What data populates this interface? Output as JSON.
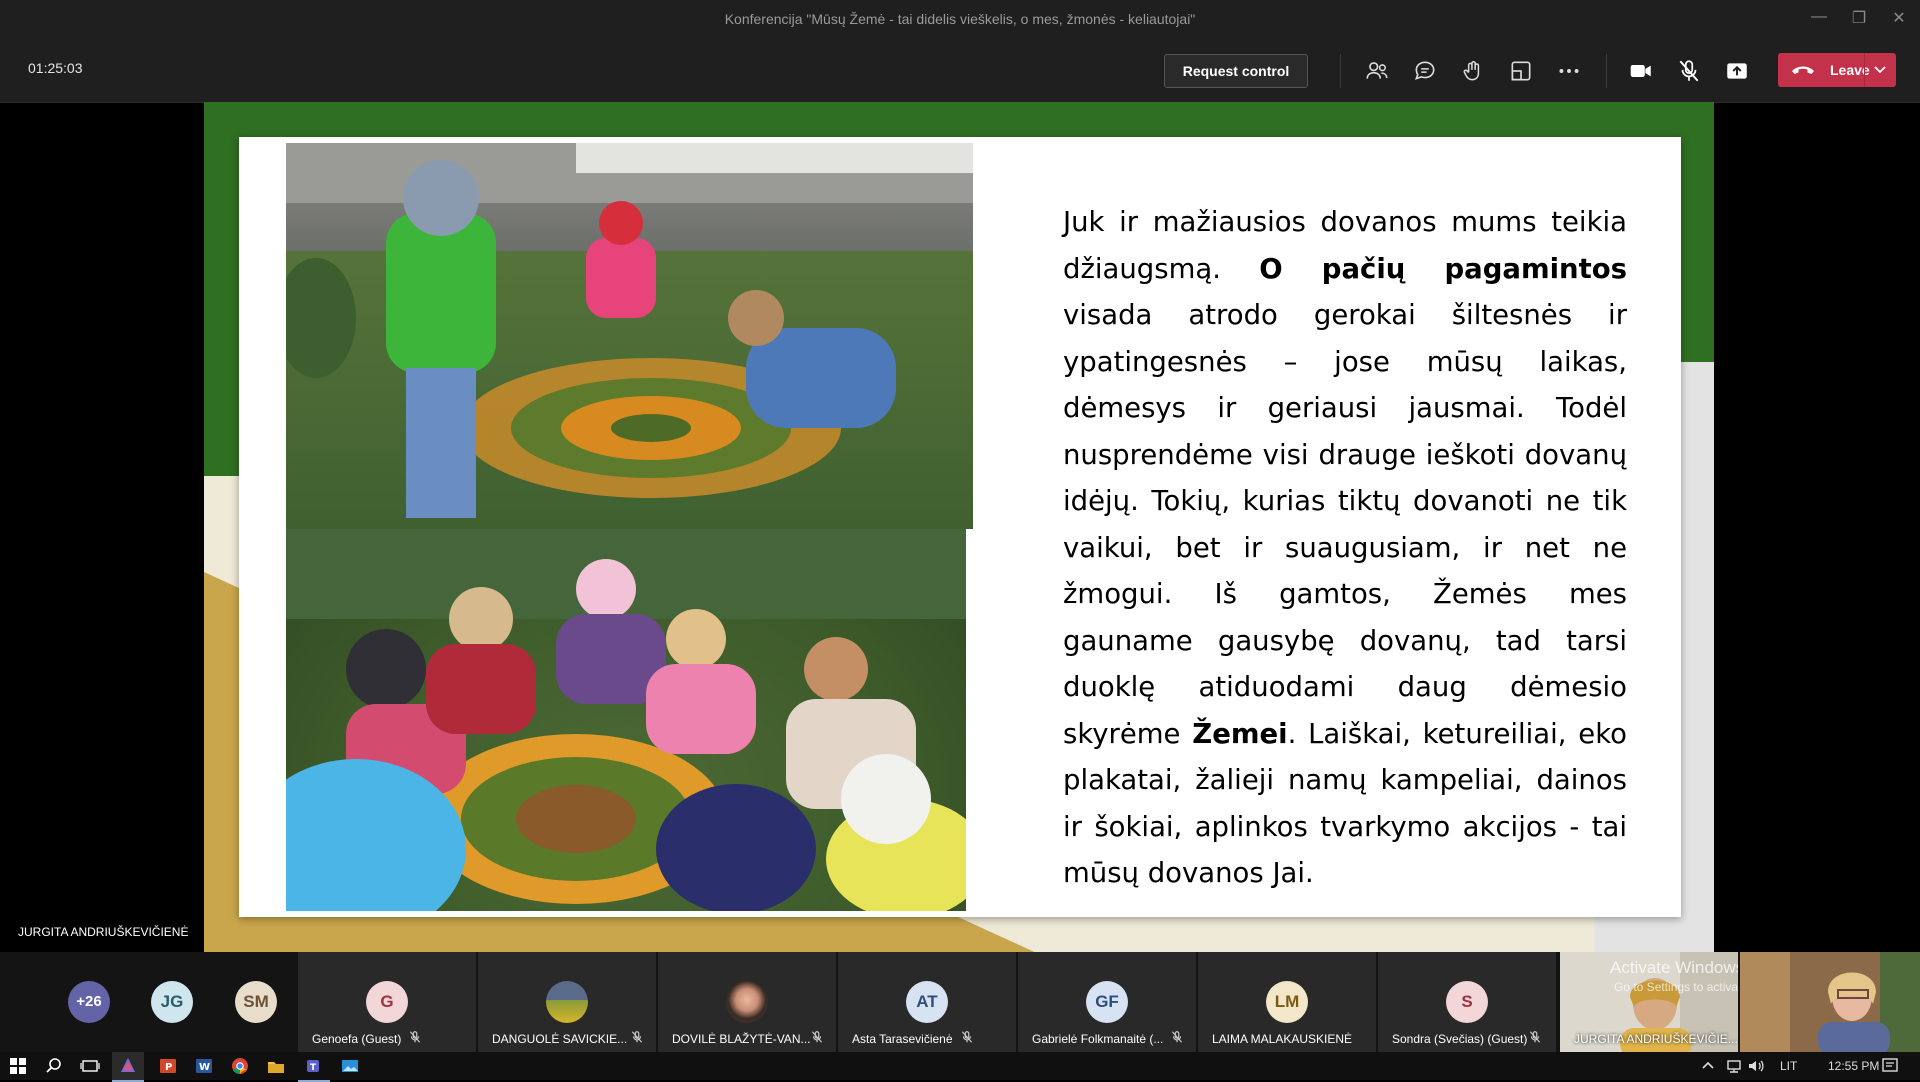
{
  "window": {
    "title": "Konferencija \"Mūsų Žemė - tai didelis vieškelis, o mes, žmonės - keliautojai\""
  },
  "toolbar": {
    "timer": "01:25:03",
    "request_control_label": "Request control",
    "leave_label": "Leave"
  },
  "slide": {
    "paragraph": [
      {
        "t": "Juk ir mažiausios dovanos mums teikia džiaugsmą. ",
        "b": false
      },
      {
        "t": "O pačių pagamintos",
        "b": true
      },
      {
        "t": " visada atrodo gerokai šiltesnės ir ypatingesnės – jose mūsų laikas, dėmesys ir geriausi jausmai. Todėl nusprendėme visi drauge ieškoti dovanų idėjų. Tokių, kurias tiktų dovanoti  ne tik vaikui, bet ir suaugusiam, ir net ne žmogui. Iš gamtos, Žemės mes gauname gausybę dovanų, tad tarsi duoklę atiduodami daug dėmesio skyrėme ",
        "b": false
      },
      {
        "t": "Žemei",
        "b": true
      },
      {
        "t": ". Laiškai, ketureiliai, eko plakatai, žalieji namų kampeliai, dainos ir šokiai, aplinkos tvarkymo akcijos  - tai mūsų dovanos Jai.",
        "b": false
      }
    ]
  },
  "presenter": {
    "name": "JURGITA ANDRIUŠKEVIČIENĖ"
  },
  "participants": {
    "overflow": "+26",
    "small_avatars": [
      {
        "initials": "JG",
        "color": "#cfe6ee"
      },
      {
        "initials": "SM",
        "color": "#e8dccb"
      }
    ],
    "tiles": [
      {
        "name": "Genoefa (Guest)",
        "initials": "G",
        "color": "#f3d6d8",
        "fg": "#a0323f"
      },
      {
        "name": "DANGUOLĖ SAVICKIE...",
        "initials": "",
        "color": "#6f7f46",
        "fg": "#fff"
      },
      {
        "name": "DOVILĖ BLAŽYTĖ-VAN...",
        "initials": "",
        "color": "#4a3a34",
        "fg": "#fff"
      },
      {
        "name": "Asta Tarasevičienė",
        "initials": "AT",
        "color": "#d7e3f3",
        "fg": "#2d4f7c"
      },
      {
        "name": "Gabrielė Folkmanaitė (...",
        "initials": "GF",
        "color": "#d7e3f3",
        "fg": "#2d4f7c"
      },
      {
        "name": "LAIMA MALAKAUSKIENĖ",
        "initials": "LM",
        "color": "#f3e7c9",
        "fg": "#7a5a13"
      },
      {
        "name": "Sondra (Svečias) (Guest)",
        "initials": "S",
        "color": "#f3d6d8",
        "fg": "#a0323f"
      }
    ],
    "video_name": "JURGITA ANDRIUŠKEVIČIE...",
    "watermark_line1": "Activate Windows",
    "watermark_line2": "Go to Settings to activate Windows."
  },
  "taskbar": {
    "lang": "LIT",
    "time": "12:55 PM"
  }
}
